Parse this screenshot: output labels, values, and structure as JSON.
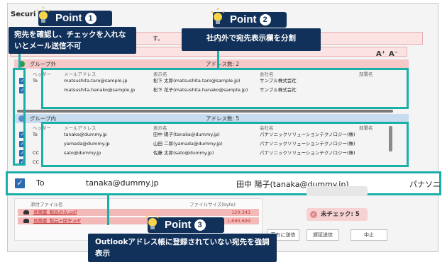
{
  "window": {
    "title": "Securi"
  },
  "infobar": {
    "text": "す。"
  },
  "font_buttons": {
    "increase": "A⁺",
    "decrease": "A⁻"
  },
  "groups": {
    "outside": {
      "label": "グループ外",
      "count": "アドレス数: 2",
      "columns": [
        "ヘッダー",
        "メールアドレス",
        "表示名",
        "会社名",
        "部署名"
      ],
      "rows": [
        {
          "header": "To",
          "email": "matsushita.taro@sample.jp",
          "display": "松下 太郎(matsushita.taro@sample.jp)",
          "company": "サンプル株式会社"
        },
        {
          "header": "",
          "email": "matsushita.hanako@sample.jp",
          "display": "松下 花子(matsushita.hanako@sample.jp)",
          "company": "サンプル株式会社"
        }
      ]
    },
    "inside": {
      "label": "グループ内",
      "count": "アドレス数: 5",
      "columns": [
        "ヘッダー",
        "メールアドレス",
        "表示名",
        "会社名",
        "部署名"
      ],
      "rows": [
        {
          "header": "To",
          "email": "tanaka@dummy.jp",
          "display": "田中 陽子(tanaka@dummy.jp)",
          "company": "パナソニックソリューションテクノロジー(株)"
        },
        {
          "header": "",
          "email": "yamada@dummy.jp",
          "display": "山田 二郎(yamada@dummy.jp)",
          "company": "パナソニックソリューションテクノロジー(株)"
        },
        {
          "header": "CC",
          "email": "sato@dummy.jp",
          "display": "佐藤 太郎(sato@dummy.jp)",
          "company": "パナソニックソリューションテクノロジー(株)"
        },
        {
          "header": "CC",
          "email": "",
          "display": "",
          "company": ""
        }
      ]
    }
  },
  "magnified_row": {
    "header": "To",
    "email": "tanaka@dummy.jp",
    "display": "田中 陽子(tanaka@dummy.jp)",
    "company": "パナソニ"
  },
  "attachments": {
    "columns": [
      "添付ファイル名",
      "ファイルサイズ(byte)"
    ],
    "rows": [
      {
        "name": "見積書_製品のみ.pdf",
        "size": "120,343"
      },
      {
        "name": "見積書_製品+保守.pdf",
        "size": "1,690,699"
      }
    ]
  },
  "status": {
    "unchecked": "未チェック: 5"
  },
  "buttons": {
    "send_now": "直ちに送信",
    "delay_send": "遅延送信",
    "cancel": "中止"
  },
  "callouts": [
    {
      "point": "Point",
      "num": "1",
      "text": "宛先を確認し、チェックを入れないとメール送信不可"
    },
    {
      "point": "Point",
      "num": "2",
      "text": "社内外で宛先表示欄を分割"
    },
    {
      "point": "Point",
      "num": "3",
      "text": "Outlookアドレス帳に登録されていない宛先を強調表示"
    }
  ],
  "colors": {
    "accent": "#1ab0a8",
    "callout_bg": "#12315a",
    "outside_group": "#f6c8c8",
    "inside_group": "#c7dcef",
    "checkbox": "#2b6cb0"
  }
}
